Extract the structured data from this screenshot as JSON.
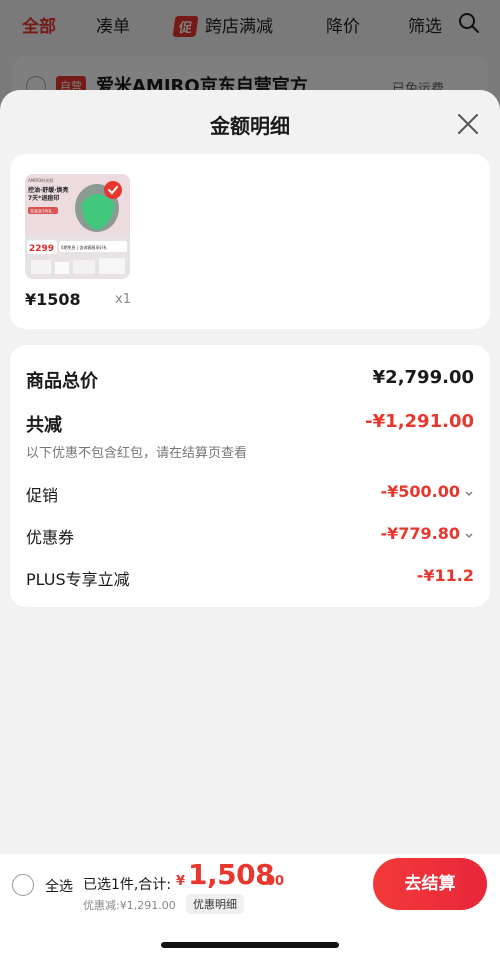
{
  "background": {
    "tabs": [
      {
        "label": "全部"
      },
      {
        "label": "凑单"
      },
      {
        "badge": "促",
        "label": "跨店满减"
      },
      {
        "label": "降价"
      },
      {
        "label": "筛选"
      }
    ],
    "store": {
      "badge": "自营",
      "name": "爱米AMIRO京东自营官方",
      "shipping": "已免运费"
    }
  },
  "sheet": {
    "title": "金额明细"
  },
  "product": {
    "thumb_text": {
      "brand": "AMIRO时光机",
      "line1": "控油·舒缓·焕亮",
      "line2": "7天*退痘印",
      "promo": "至高享3件礼",
      "price": "2299",
      "benefit": "6期免息 | 咨询客服享好礼"
    },
    "price": "¥1508",
    "qty": "x1"
  },
  "summary": {
    "total_label": "商品总价",
    "total_value": "¥2,799.00",
    "reduce_label": "共减",
    "reduce_value": "-¥1,291.00",
    "note": "以下优惠不包含红包，请在结算页查看",
    "promo_label": "促销",
    "promo_value": "-¥500.00",
    "coupon_label": "优惠券",
    "coupon_value": "-¥779.80",
    "plus_label": "PLUS专享立减",
    "plus_value": "-¥11.2"
  },
  "bottom_bar": {
    "select_all": "全选",
    "selected_text": "已选1件,合计:",
    "currency": "¥",
    "total_int": "1,508",
    "total_dec": ".00",
    "discount_text": "优惠减:¥1,291.00",
    "detail_chip": "优惠明细",
    "checkout": "去结算"
  },
  "colors": {
    "accent_red": "#e8372e",
    "checkout_gradient_start": "#f23a3a",
    "checkout_gradient_end": "#e8263a",
    "sheet_bg": "#f2f2f2"
  }
}
